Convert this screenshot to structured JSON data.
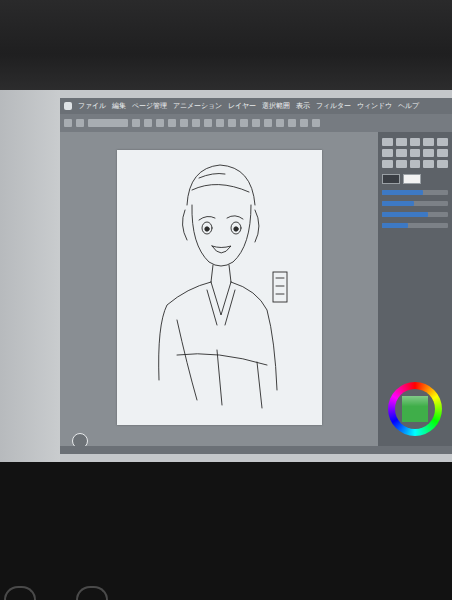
{
  "menu": [
    {
      "label": "ファイル"
    },
    {
      "label": "編集"
    },
    {
      "label": "ページ管理"
    },
    {
      "label": "アニメーション"
    },
    {
      "label": "レイヤー"
    },
    {
      "label": "選択範囲"
    },
    {
      "label": "表示"
    },
    {
      "label": "フィルター"
    },
    {
      "label": "ウィンドウ"
    },
    {
      "label": "ヘルプ"
    }
  ],
  "color_wheel": {
    "current_color": "#3fae49"
  }
}
